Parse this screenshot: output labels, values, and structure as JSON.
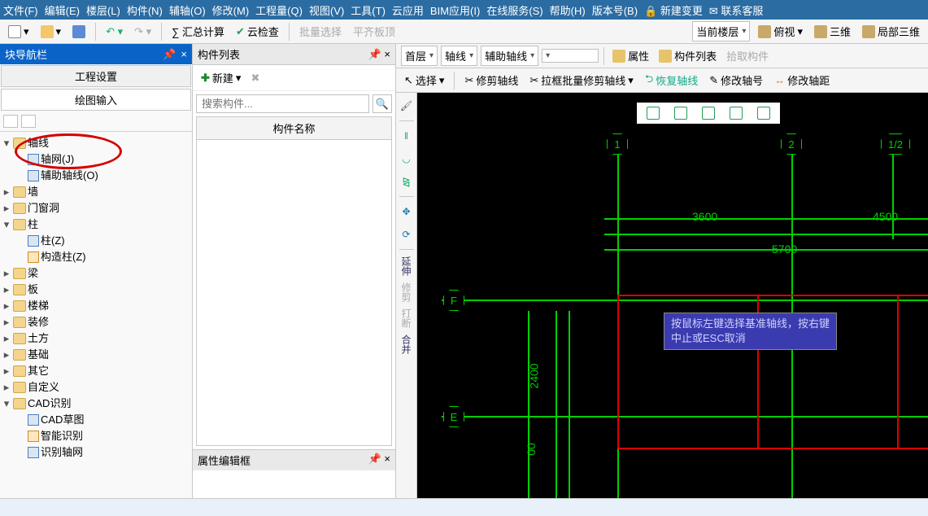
{
  "menu": [
    "文件(F)",
    "编辑(E)",
    "楼层(L)",
    "构件(N)",
    "辅轴(O)",
    "修改(M)",
    "工程量(Q)",
    "视图(V)",
    "工具(T)",
    "云应用",
    "BIM应用(I)",
    "在线服务(S)",
    "帮助(H)",
    "版本号(B)",
    "🔒 新建变更",
    "✉ 联系客服"
  ],
  "toolbar1": {
    "sum": "∑ 汇总计算",
    "cloud": "云检查",
    "batch": "批量选择",
    "flat": "平齐板顶",
    "floor": "当前楼层",
    "ortho": "俯视",
    "threeD": "三维",
    "local3d": "局部三维"
  },
  "nav": {
    "title": "块导航栏",
    "tabs": [
      "工程设置",
      "绘图输入"
    ],
    "tree_axis": "轴线",
    "tree_grid": "轴网(J)",
    "tree_aux": "辅助轴线(O)",
    "tree_wall": "墙",
    "tree_door": "门窗洞",
    "tree_col": "柱",
    "tree_col_z": "柱(Z)",
    "tree_col_gz": "构造柱(Z)",
    "tree_beam": "梁",
    "tree_slab": "板",
    "tree_stairs": "楼梯",
    "tree_deco": "装修",
    "tree_earth": "土方",
    "tree_found": "基础",
    "tree_other": "其它",
    "tree_custom": "自定义",
    "tree_cad": "CAD识别",
    "tree_cad_draft": "CAD草图",
    "tree_cad_smart": "智能识别",
    "tree_cad_axis": "识别轴网"
  },
  "mid": {
    "title": "构件列表",
    "new": "新建",
    "search_ph": "搜索构件...",
    "col_header": "构件名称",
    "prop_title": "属性编辑框"
  },
  "draw": {
    "floor": "首层",
    "cat": "轴线",
    "sub": "辅助轴线",
    "prop": "属性",
    "list": "构件列表",
    "pick": "拾取构件",
    "select": "选择",
    "trim": "修剪轴线",
    "batch_trim": "拉框批量修剪轴线",
    "restore": "恢复轴线",
    "edit_no": "修改轴号",
    "edit_dist": "修改轴距"
  },
  "vlabels": [
    "延伸",
    "修剪",
    "打断",
    "合并"
  ],
  "tooltip_l1": "按鼠标左键选择基准轴线，按右键",
  "tooltip_l2": "中止或ESC取消",
  "bubbles": {
    "b1": "1",
    "b2": "2",
    "b12": "1/2",
    "bF": "F",
    "bE": "E"
  },
  "dims": {
    "d3600": "3600",
    "d4500": "4500",
    "d5700": "5700",
    "d2400": "2400",
    "d00": "00"
  }
}
